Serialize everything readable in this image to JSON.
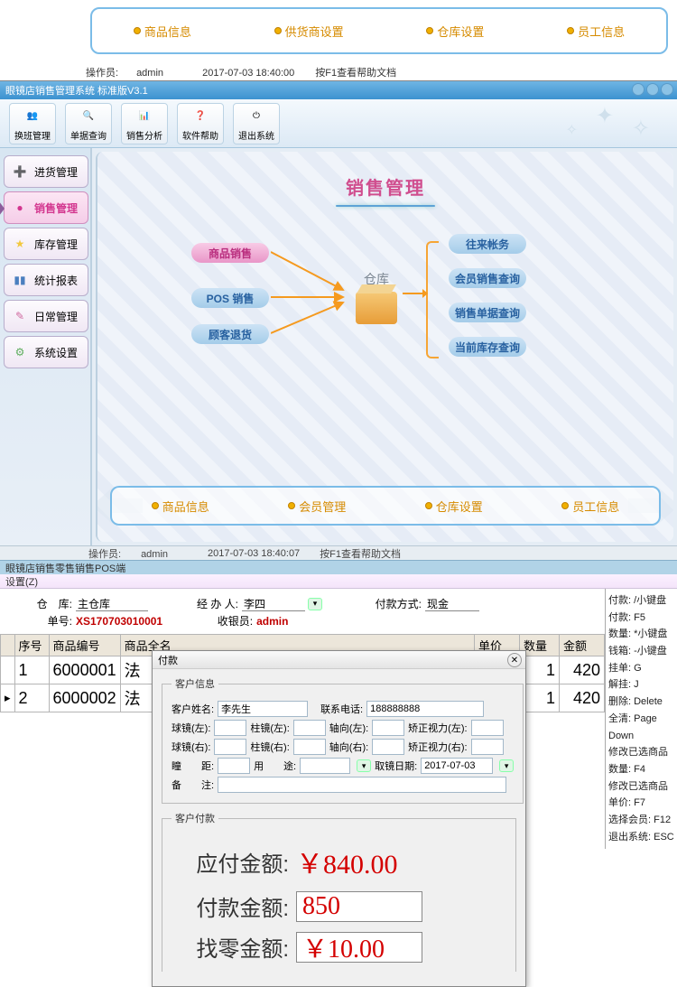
{
  "top_links": [
    "商品信息",
    "供货商设置",
    "仓库设置",
    "员工信息"
  ],
  "status1": {
    "operator_label": "操作员:",
    "operator": "admin",
    "time": "2017-07-03 18:40:00",
    "help": "按F1查看帮助文档"
  },
  "app_title": "眼镜店销售管理系统 标准版V3.1",
  "toolbar": [
    {
      "label": "换班管理",
      "icon": "👥",
      "name": "shift-manage"
    },
    {
      "label": "单据查询",
      "icon": "🔍",
      "name": "doc-query"
    },
    {
      "label": "销售分析",
      "icon": "📊",
      "name": "sales-analysis"
    },
    {
      "label": "软件帮助",
      "icon": "❓",
      "name": "software-help"
    },
    {
      "label": "退出系统",
      "icon": "⏻",
      "name": "exit-system"
    }
  ],
  "sidebar": [
    {
      "label": "进货管理",
      "icon": "➕",
      "name": "purchase-manage",
      "color": "#3fae3f"
    },
    {
      "label": "销售管理",
      "icon": "●",
      "name": "sales-manage",
      "color": "#d3378f",
      "active": true
    },
    {
      "label": "库存管理",
      "icon": "★",
      "name": "inventory-manage",
      "color": "#f2c83f"
    },
    {
      "label": "统计报表",
      "icon": "▮▮",
      "name": "stat-report",
      "color": "#4a7fbf"
    },
    {
      "label": "日常管理",
      "icon": "✎",
      "name": "daily-manage",
      "color": "#d06aa0"
    },
    {
      "label": "系统设置",
      "icon": "⚙",
      "name": "system-settings",
      "color": "#5fae5f"
    }
  ],
  "page_heading": "销售管理",
  "cube_label": "仓库",
  "diagram_left": [
    "商品销售",
    "POS 销售",
    "顾客退货"
  ],
  "diagram_right": [
    "往来帐务",
    "会员销售查询",
    "销售单据查询",
    "当前库存查询"
  ],
  "bottom_links": [
    "商品信息",
    "会员管理",
    "仓库设置",
    "员工信息"
  ],
  "status2": {
    "operator_label": "操作员:",
    "operator": "admin",
    "time": "2017-07-03 18:40:07",
    "help": "按F1查看帮助文档"
  },
  "pos_title": "眼镜店销售零售销售POS端",
  "pos_menu": "设置(Z)",
  "pos_head": {
    "warehouse_label": "仓　库:",
    "warehouse": "主仓库",
    "handler_label": "经 办 人:",
    "handler": "李四",
    "paymethod_label": "付款方式:",
    "paymethod": "现金",
    "docno_label": "单号:",
    "docno": "XS170703010001",
    "cashier_label": "收银员:",
    "cashier": "admin"
  },
  "table": {
    "headers": [
      "序号",
      "商品编号",
      "商品全名",
      "单价",
      "数量",
      "金额"
    ],
    "rows": [
      {
        "idx": "1",
        "code": "6000001",
        "name": "法",
        "qty": "1",
        "amt": "420"
      },
      {
        "idx": "2",
        "code": "6000002",
        "name": "法",
        "qty": "1",
        "amt": "420"
      }
    ]
  },
  "shortcuts": [
    "付款: /小键盘",
    "付款: F5",
    "数量: *小键盘",
    "钱箱: -小键盘",
    "挂单: G",
    "解挂: J",
    "删除: Delete",
    "全清: Page Down",
    "修改已选商品数量: F4",
    "修改已选商品单价: F7",
    "选择会员: F12",
    "退出系统: ESC"
  ],
  "dialog": {
    "title": "付款",
    "group1_title": "客户信息",
    "name_label": "客户姓名:",
    "name": "李先生",
    "phone_label": "联系电话:",
    "phone": "188888888",
    "sphL_label": "球镜(左):",
    "cylL_label": "柱镜(左):",
    "axisL_label": "轴向(左):",
    "corrL_label": "矫正视力(左):",
    "sphR_label": "球镜(右):",
    "cylR_label": "柱镜(右):",
    "axisR_label": "轴向(右):",
    "corrR_label": "矫正视力(右):",
    "pd_label": "瞳　　距:",
    "use_label": "用　　途:",
    "date_label": "取镜日期:",
    "date": "2017-07-03",
    "remark_label": "备　　注:",
    "group2_title": "客户付款",
    "due_label": "应付金额:",
    "due": "￥840.00",
    "pay_label": "付款金额:",
    "pay": "850",
    "change_label": "找零金额:",
    "change": "￥10.00"
  }
}
